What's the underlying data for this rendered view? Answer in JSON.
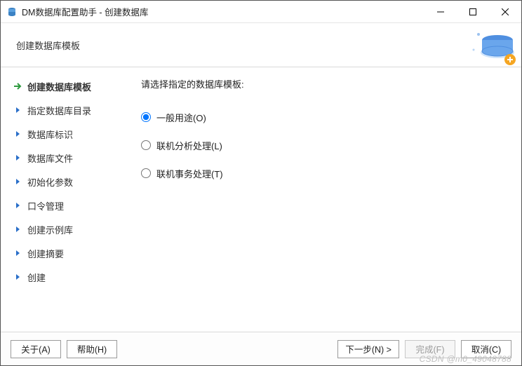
{
  "titlebar": {
    "title": "DM数据库配置助手 - 创建数据库"
  },
  "header": {
    "subtitle": "创建数据库模板"
  },
  "sidebar": {
    "items": [
      {
        "label": "创建数据库模板",
        "active": true
      },
      {
        "label": "指定数据库目录"
      },
      {
        "label": "数据库标识"
      },
      {
        "label": "数据库文件"
      },
      {
        "label": "初始化参数"
      },
      {
        "label": "口令管理"
      },
      {
        "label": "创建示例库"
      },
      {
        "label": "创建摘要"
      },
      {
        "label": "创建"
      }
    ]
  },
  "content": {
    "prompt": "请选择指定的数据库模板:",
    "options": [
      {
        "label": "一般用途(O)",
        "selected": true
      },
      {
        "label": "联机分析处理(L)",
        "selected": false
      },
      {
        "label": "联机事务处理(T)",
        "selected": false
      }
    ]
  },
  "footer": {
    "about": "关于(A)",
    "help": "帮助(H)",
    "next": "下一步(N) >",
    "finish": "完成(F)",
    "cancel": "取消(C)"
  },
  "watermark": "CSDN @m0_49048788"
}
